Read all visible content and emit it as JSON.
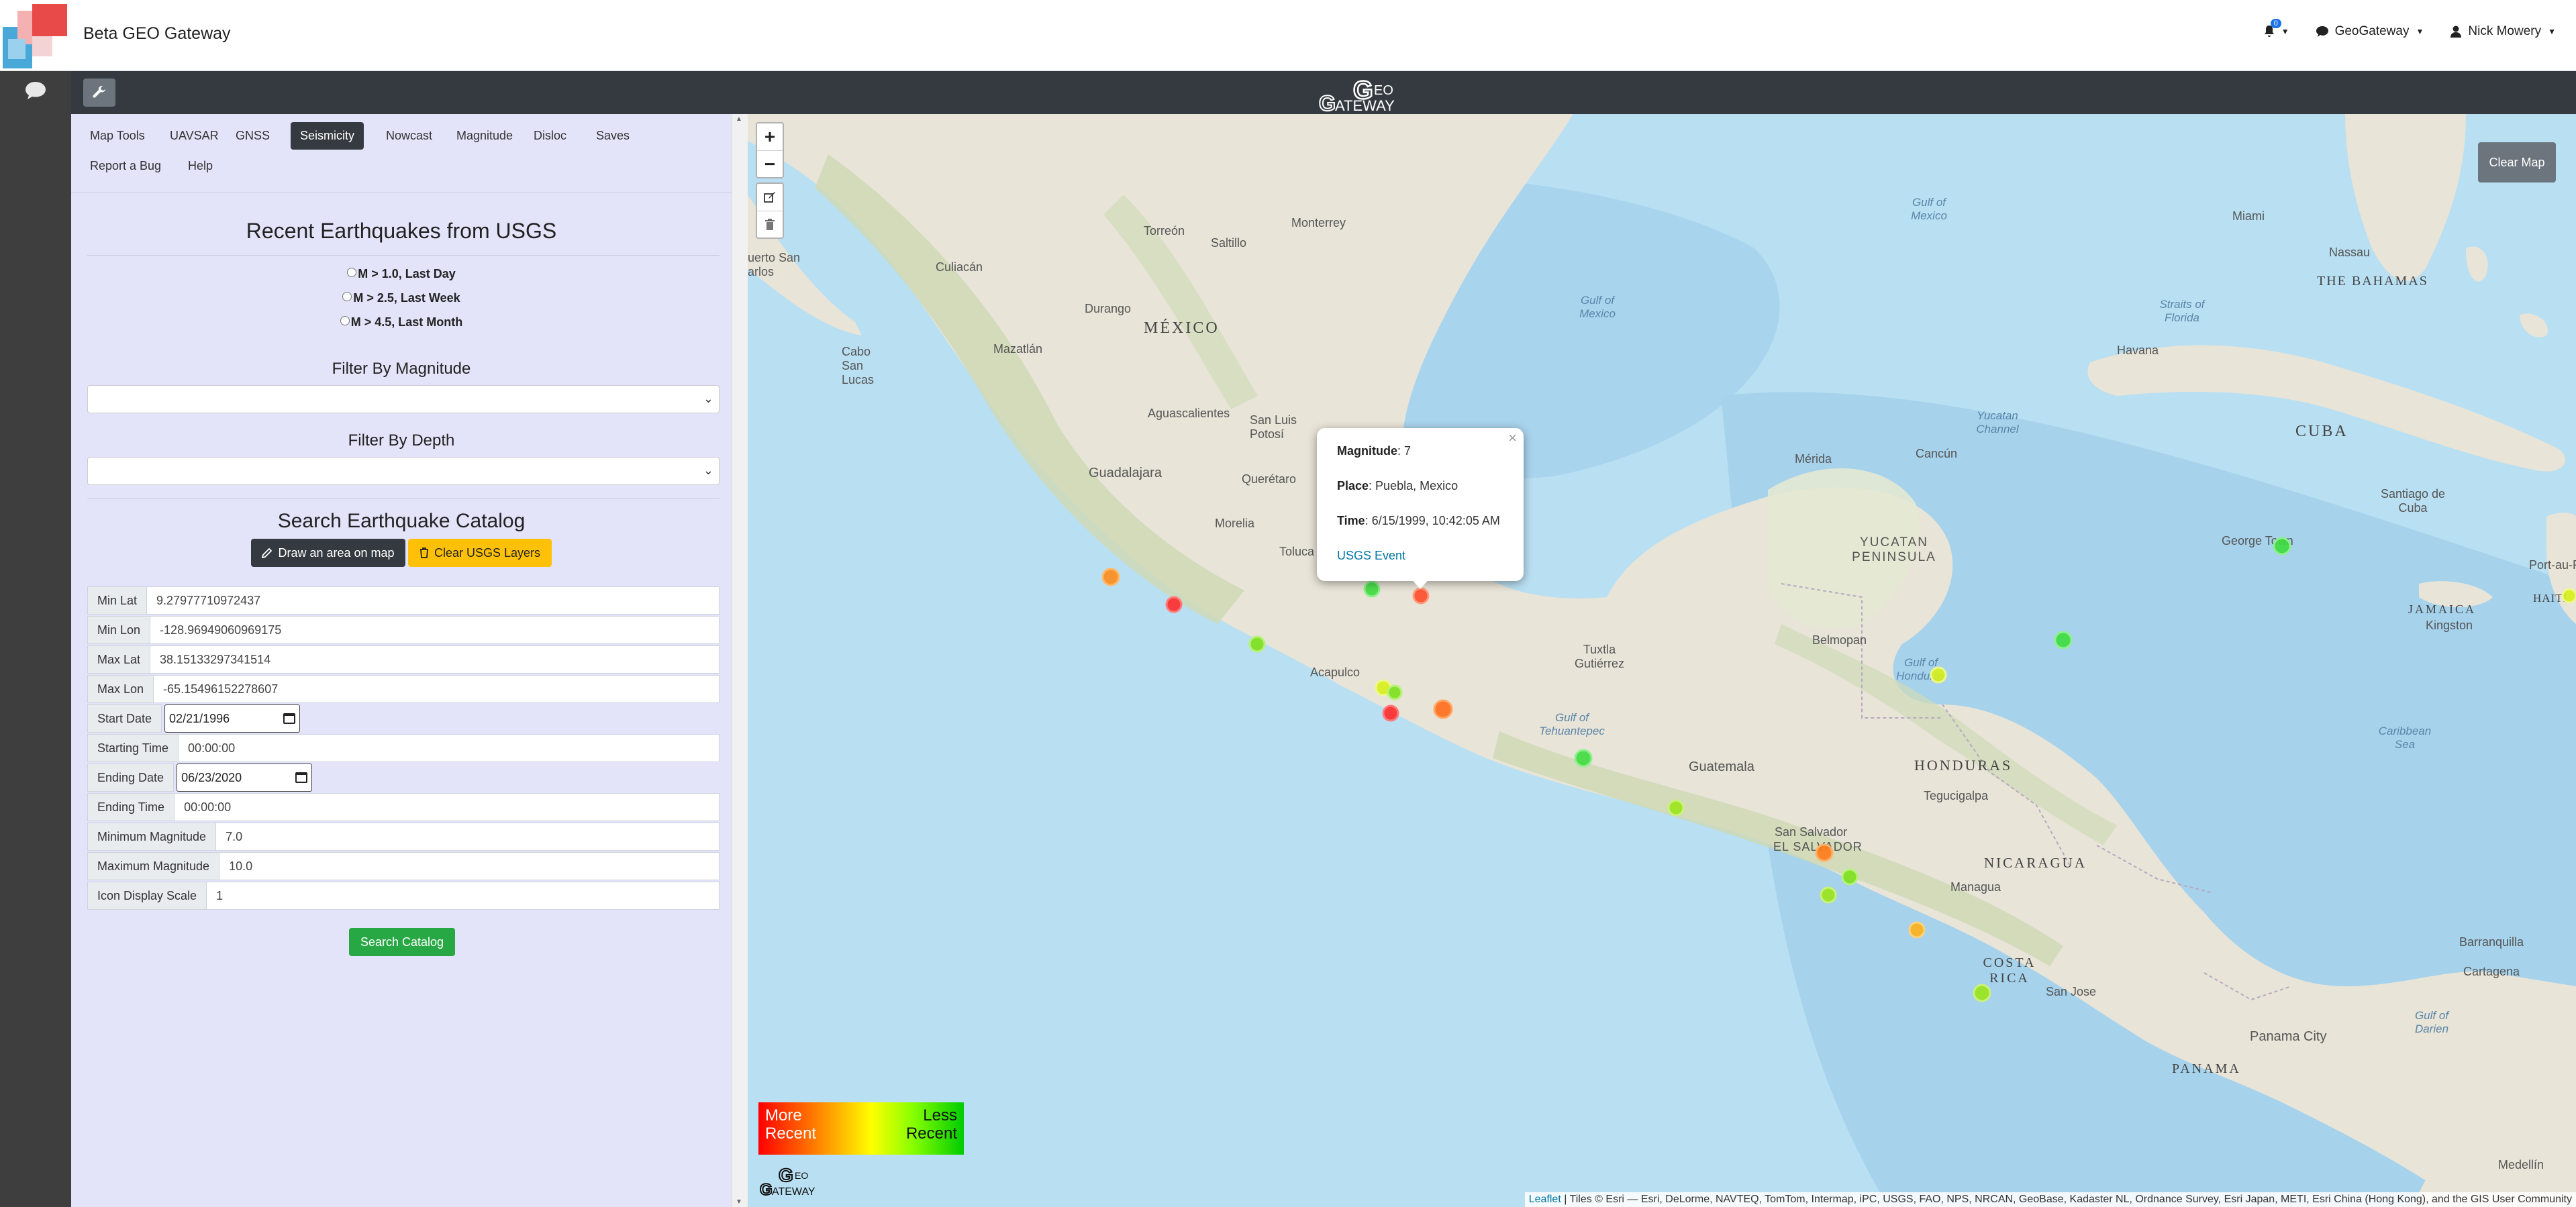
{
  "header": {
    "title": "Beta GEO Gateway",
    "notification_count": "0",
    "project_menu": "GeoGateway",
    "user_menu": "Nick Mowery"
  },
  "tabs": [
    {
      "label": "Map Tools"
    },
    {
      "label": "UAVSAR"
    },
    {
      "label": "GNSS"
    },
    {
      "label": "Seismicity",
      "active": true
    },
    {
      "label": "Nowcast"
    },
    {
      "label": "Magnitude"
    },
    {
      "label": "Disloc"
    },
    {
      "label": "Saves"
    },
    {
      "label": "Report a Bug"
    },
    {
      "label": "Help"
    }
  ],
  "recent": {
    "title": "Recent Earthquakes from USGS",
    "options": [
      "M > 1.0, Last Day",
      "M > 2.5, Last Week",
      "M > 4.5, Last Month"
    ]
  },
  "filters": {
    "magnitude_label": "Filter By Magnitude",
    "magnitude_value": "",
    "depth_label": "Filter By Depth",
    "depth_value": ""
  },
  "catalog": {
    "title": "Search Earthquake Catalog",
    "draw_button": "Draw an area on map",
    "clear_button": "Clear USGS Layers",
    "fields": {
      "min_lat": {
        "label": "Min Lat",
        "value": "9.27977710972437"
      },
      "min_lon": {
        "label": "Min Lon",
        "value": "-128.96949060969175"
      },
      "max_lat": {
        "label": "Max Lat",
        "value": "38.15133297341514"
      },
      "max_lon": {
        "label": "Max Lon",
        "value": "-65.15496152278607"
      },
      "start_date": {
        "label": "Start Date",
        "value": "02/21/1996"
      },
      "start_time": {
        "label": "Starting Time",
        "value": "00:00:00"
      },
      "end_date": {
        "label": "Ending Date",
        "value": "06/23/2020"
      },
      "end_time": {
        "label": "Ending Time",
        "value": "00:00:00"
      },
      "min_mag": {
        "label": "Minimum Magnitude",
        "value": "7.0"
      },
      "max_mag": {
        "label": "Maximum Magnitude",
        "value": "10.0"
      },
      "icon_scale": {
        "label": "Icon Display Scale",
        "value": "1"
      }
    },
    "search_button": "Search Catalog"
  },
  "map": {
    "clear_button": "Clear Map",
    "zoom_in": "+",
    "zoom_out": "−",
    "labels": {
      "mexico": "MÉXICO",
      "monterrey": "Monterrey",
      "torreon": "Torreón",
      "saltillo": "Saltillo",
      "culiacan": "Culiacán",
      "durango": "Durango",
      "mazatlan": "Mazatlán",
      "aguascalientes": "Aguascalientes",
      "san_luis": "San Luis Potosí",
      "guadalajara": "Guadalajara",
      "queretaro": "Querétaro",
      "morelia": "Morelia",
      "toluca": "Toluca",
      "acapulco": "Acapulco",
      "merida": "Mérida",
      "cancun": "Cancún",
      "belmopan": "Belmopan",
      "tuxtla": "Tuxtla Gutiérrez",
      "guatemala": "Guatemala",
      "honduras": "HONDURAS",
      "tegucigalpa": "Tegucigalpa",
      "san_salvador": "San Salvador",
      "el_salvador": "EL SALVADOR",
      "nicaragua": "NICARAGUA",
      "managua": "Managua",
      "costa_rica": "COSTA RICA",
      "san_jose": "San Jose",
      "panama": "PANAMA",
      "panama_city": "Panama City",
      "cuba": "CUBA",
      "havana": "Havana",
      "bahamas": "THE BAHAMAS",
      "nassau": "Nassau",
      "miami": "Miami",
      "jamaica": "JAMAICA",
      "kingston": "Kingston",
      "george_town": "George Town",
      "santiago": "Santiago de Cuba",
      "yucatan_peninsula": "YUCATAN PENINSULA",
      "gulf_of_mexico": "Gulf of Mexico",
      "gulf_of_mexico_2": "Gulf of Mexico",
      "yucatan_channel": "Yucatan Channel",
      "gulf_tehuantepec": "Gulf of Tehuantepec",
      "gulf_honduras": "Gulf of Honduras",
      "caribbean_sea": "Caribbean Sea",
      "straits_florida": "Straits of Florida",
      "cabo_san_lucas": "Cabo San Lucas",
      "puerto_san_carlos": "uerto San arlos",
      "barranquilla": "Barranquilla",
      "cartagena": "Cartagena",
      "medellin": "Medellín",
      "gulf_darien": "Gulf of Darien",
      "port_au_prince": "Port-au-Prince",
      "haiti": "HAITI"
    },
    "popup": {
      "magnitude_label": "Magnitude",
      "magnitude_value": ": 7",
      "place_label": "Place",
      "place_value": ": Puebla, Mexico",
      "time_label": "Time",
      "time_value": ": 6/15/1999, 10:42:05 AM",
      "link": "USGS Event"
    },
    "legend": {
      "more_recent": "More Recent",
      "less_recent": "Less Recent"
    },
    "attribution_link": "Leaflet",
    "attribution_text": " | Tiles © Esri — Esri, DeLorme, NAVTEQ, TomTom, Intermap, iPC, USGS, FAO, NPS, NRCAN, GeoBase, Kadaster NL, Ordnance Survey, Esri Japan, METI, Esri China (Hong Kong), and the GIS User Community",
    "colors": {
      "recent": "#ff2a2a",
      "older": "#ff8c1a",
      "mid": "#d7ef1a",
      "oldest": "#3ddb3d"
    }
  }
}
